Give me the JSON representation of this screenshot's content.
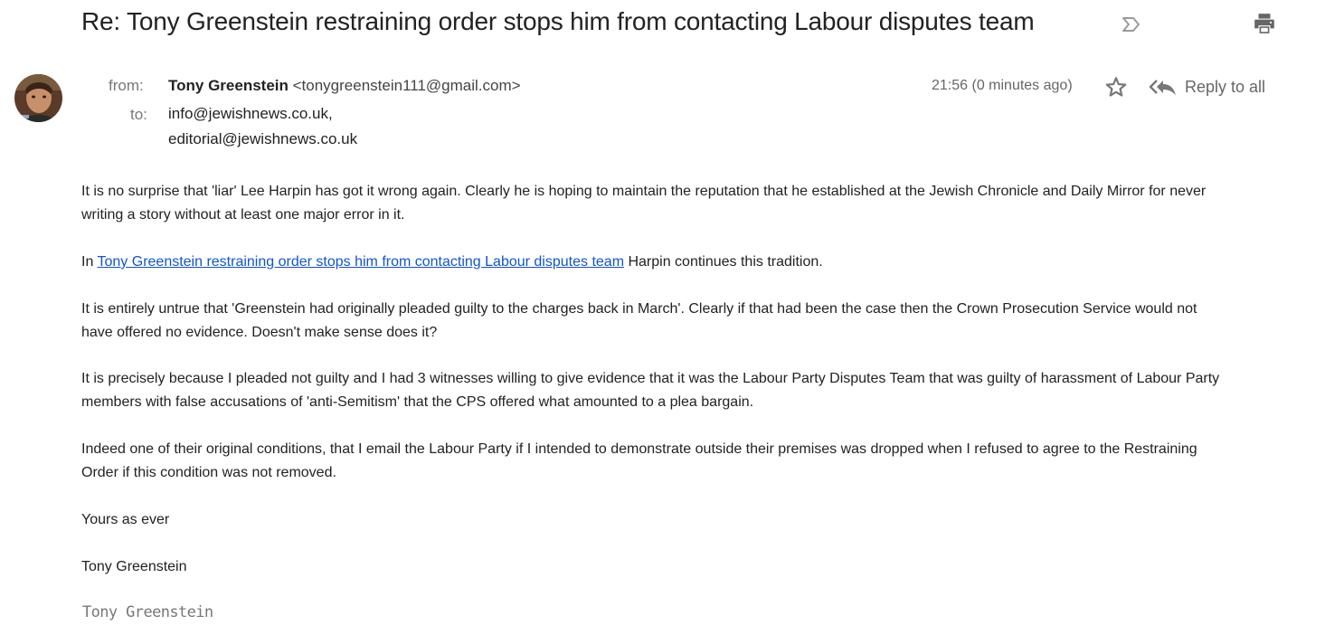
{
  "email": {
    "subject": "Re: Tony Greenstein restraining order stops him from contacting Labour disputes team",
    "from_label": "from:",
    "to_label": "to:",
    "sender_name": "Tony Greenstein",
    "sender_email": "<tonygreenstein111@gmail.com>",
    "recipients": [
      "info@jewishnews.co.uk,",
      "editorial@jewishnews.co.uk"
    ],
    "time": "21:56 (0 minutes ago)",
    "reply_all_label": "Reply to all"
  },
  "icons": {
    "important": "important-marker-icon",
    "print": "print-icon",
    "star": "star-icon",
    "reply_all": "reply-all-icon",
    "avatar": "avatar"
  },
  "colors": {
    "link": "#1155cc",
    "text": "#222222",
    "muted": "#777777"
  },
  "body": {
    "p1_line1": "It is no surprise that 'liar' Lee Harpin has got it wrong again.  Clearly he is hoping to maintain the reputation that he established at the Jewish Chronicle and Daily Mirror for never",
    "p1_line2": "writing a story without at least one major error in it.",
    "p2_prefix": "In ",
    "p2_link": "Tony Greenstein restraining order stops him from contacting Labour disputes team",
    "p2_suffix": " Harpin continues this tradition.",
    "p3_line1": "It is entirely untrue that 'Greenstein had originally pleaded guilty to the charges back in March'. Clearly if that had been the case then the Crown Prosecution Service would not",
    "p3_line2": "have offered no evidence.  Doesn't make sense does it?",
    "p4_line1": "It is precisely because I pleaded not guilty and I had 3 witnesses willing to give evidence that it was the Labour Party Disputes Team that was guilty of harassment of Labour Party",
    "p4_line2": "members with false accusations of 'anti-Semitism' that the CPS offered what amounted to a plea bargain.",
    "p5_line1": "Indeed one of their original conditions, that I email the Labour Party if I intended to demonstrate outside their premises was dropped when I refused to agree to the Restraining",
    "p5_line2": "Order if this condition was not removed.",
    "closing": "Yours as ever",
    "name": "Tony Greenstein",
    "signature": "Tony Greenstein"
  }
}
